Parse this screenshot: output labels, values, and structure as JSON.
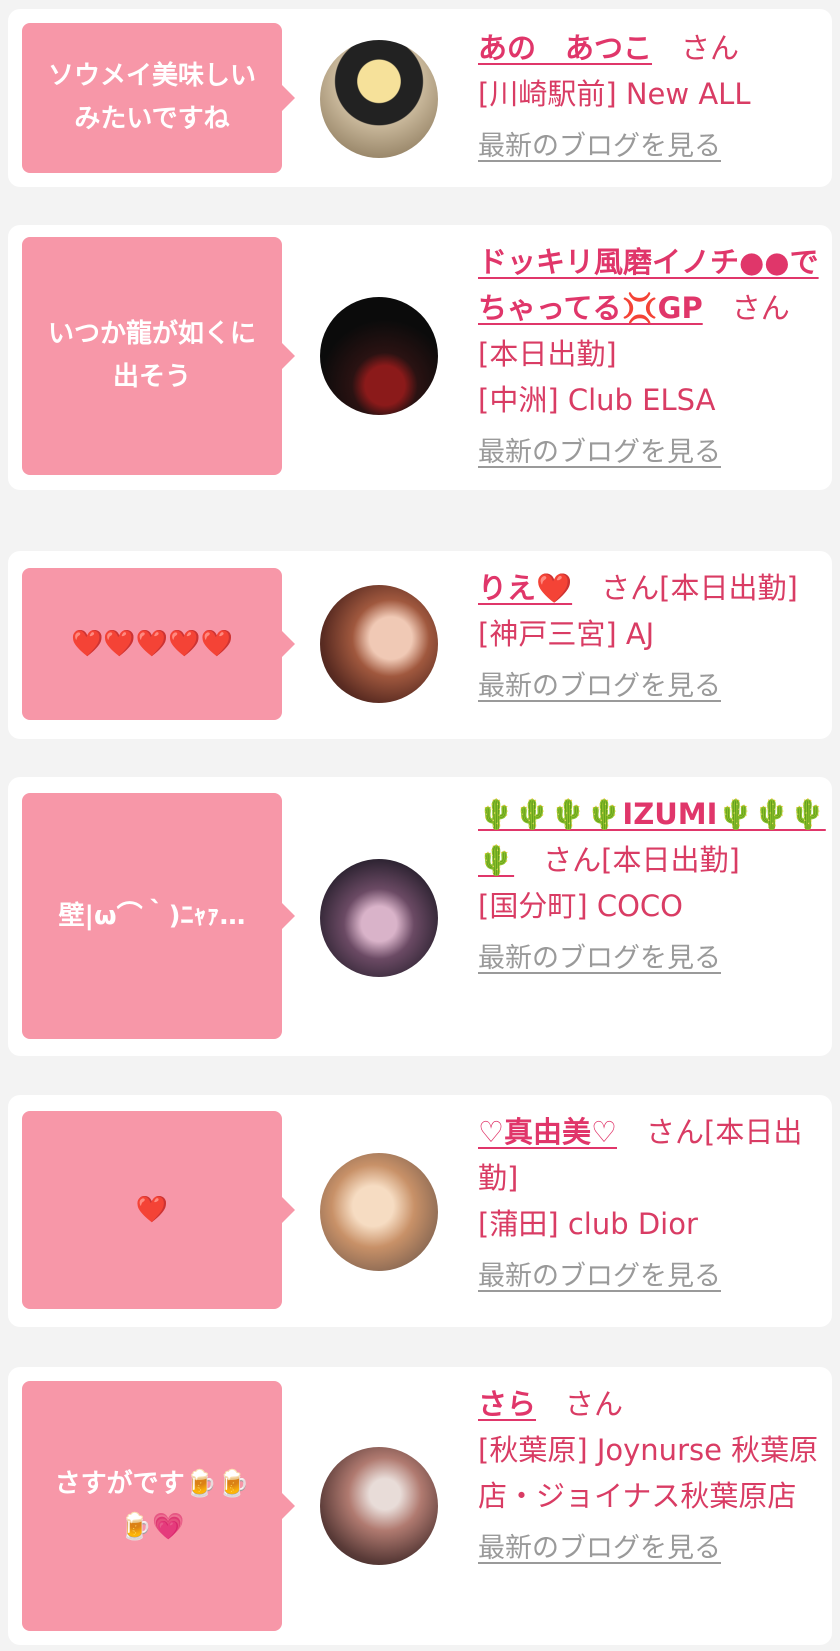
{
  "entries": [
    {
      "message": "ソウメイ美味しい\nみたいですね",
      "name": "あの　あつこ",
      "suffix": "さん",
      "shop": "[川崎駅前] New ALL",
      "blog": "最新のブログを見る",
      "avatar_icon": "avatar-doll-ramen"
    },
    {
      "message": "いつか龍が如くに\n出そう",
      "name": "ドッキリ風磨イノチ●●でちゃってる💢GP",
      "suffix": "さん[本日出勤]",
      "shop": "[中洲] Club ELSA",
      "blog": "最新のブログを見る",
      "avatar_icon": "avatar-dark-seal"
    },
    {
      "message": "❤️❤️❤️❤️❤️",
      "name": "りえ❤️",
      "suffix": "さん[本日出勤]",
      "shop": "[神戸三宮] AJ",
      "blog": "最新のブログを見る",
      "avatar_icon": "avatar-photo"
    },
    {
      "message": "壁|ω⌒｀)ﾆｬｧ…",
      "name": "🌵🌵🌵🌵IZUMI🌵🌵🌵🌵",
      "suffix": "さん[本日出勤]",
      "shop": "[国分町] COCO",
      "blog": "最新のブログを見る",
      "avatar_icon": "avatar-cat-filter"
    },
    {
      "message": "❤️",
      "name": "♡真由美♡",
      "suffix": "さん[本日出勤]",
      "shop": "[蒲田] club Dior",
      "blog": "最新のブログを見る",
      "avatar_icon": "avatar-photo"
    },
    {
      "message": "さすがです🍺🍺\n🍺💗",
      "name": "さら",
      "suffix": "さん",
      "shop": "[秋葉原] Joynurse 秋葉原店・ジョイナス秋葉原店",
      "blog": "最新のブログを見る",
      "avatar_icon": "avatar-photo"
    }
  ],
  "colors": {
    "bubble": "#f797a8",
    "accent": "#e0366a",
    "text": "#d93c64",
    "link": "#9a9a9a",
    "background": "#f3f3f3"
  }
}
